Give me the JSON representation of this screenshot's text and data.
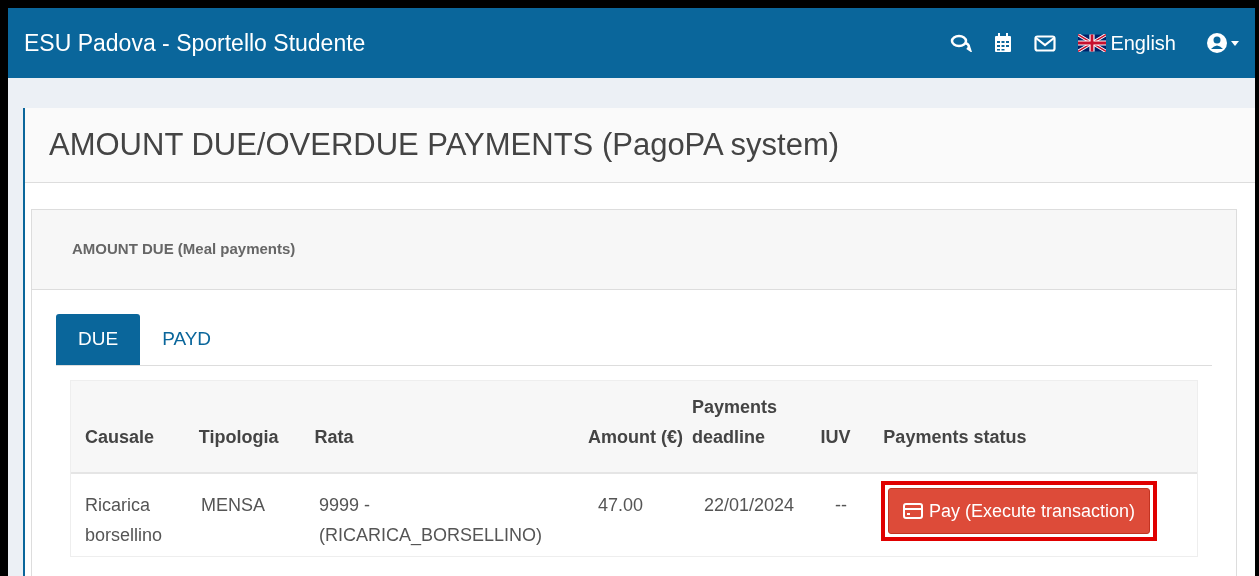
{
  "navbar": {
    "title": "ESU Padova - Sportello Studente",
    "language": "English"
  },
  "page_title": "AMOUNT DUE/OVERDUE PAYMENTS (PagoPA system)",
  "panel": {
    "title": "AMOUNT DUE (Meal payments)"
  },
  "tabs": [
    {
      "label": "DUE",
      "selected": true
    },
    {
      "label": "PAYD",
      "selected": false
    }
  ],
  "table": {
    "columns": [
      "Causale",
      "Tipologia",
      "Rata",
      "Amount (€)",
      "Payments deadline",
      "IUV",
      "Payments status"
    ],
    "rows": [
      {
        "cells": [
          "Ricarica borsellino",
          "MENSA",
          "9999 - (RICARICA_BORSELLINO)",
          "47.00",
          "22/01/2024",
          "--"
        ],
        "action": {
          "label": "Pay (Execute transaction)",
          "highlighted": true
        }
      }
    ]
  }
}
